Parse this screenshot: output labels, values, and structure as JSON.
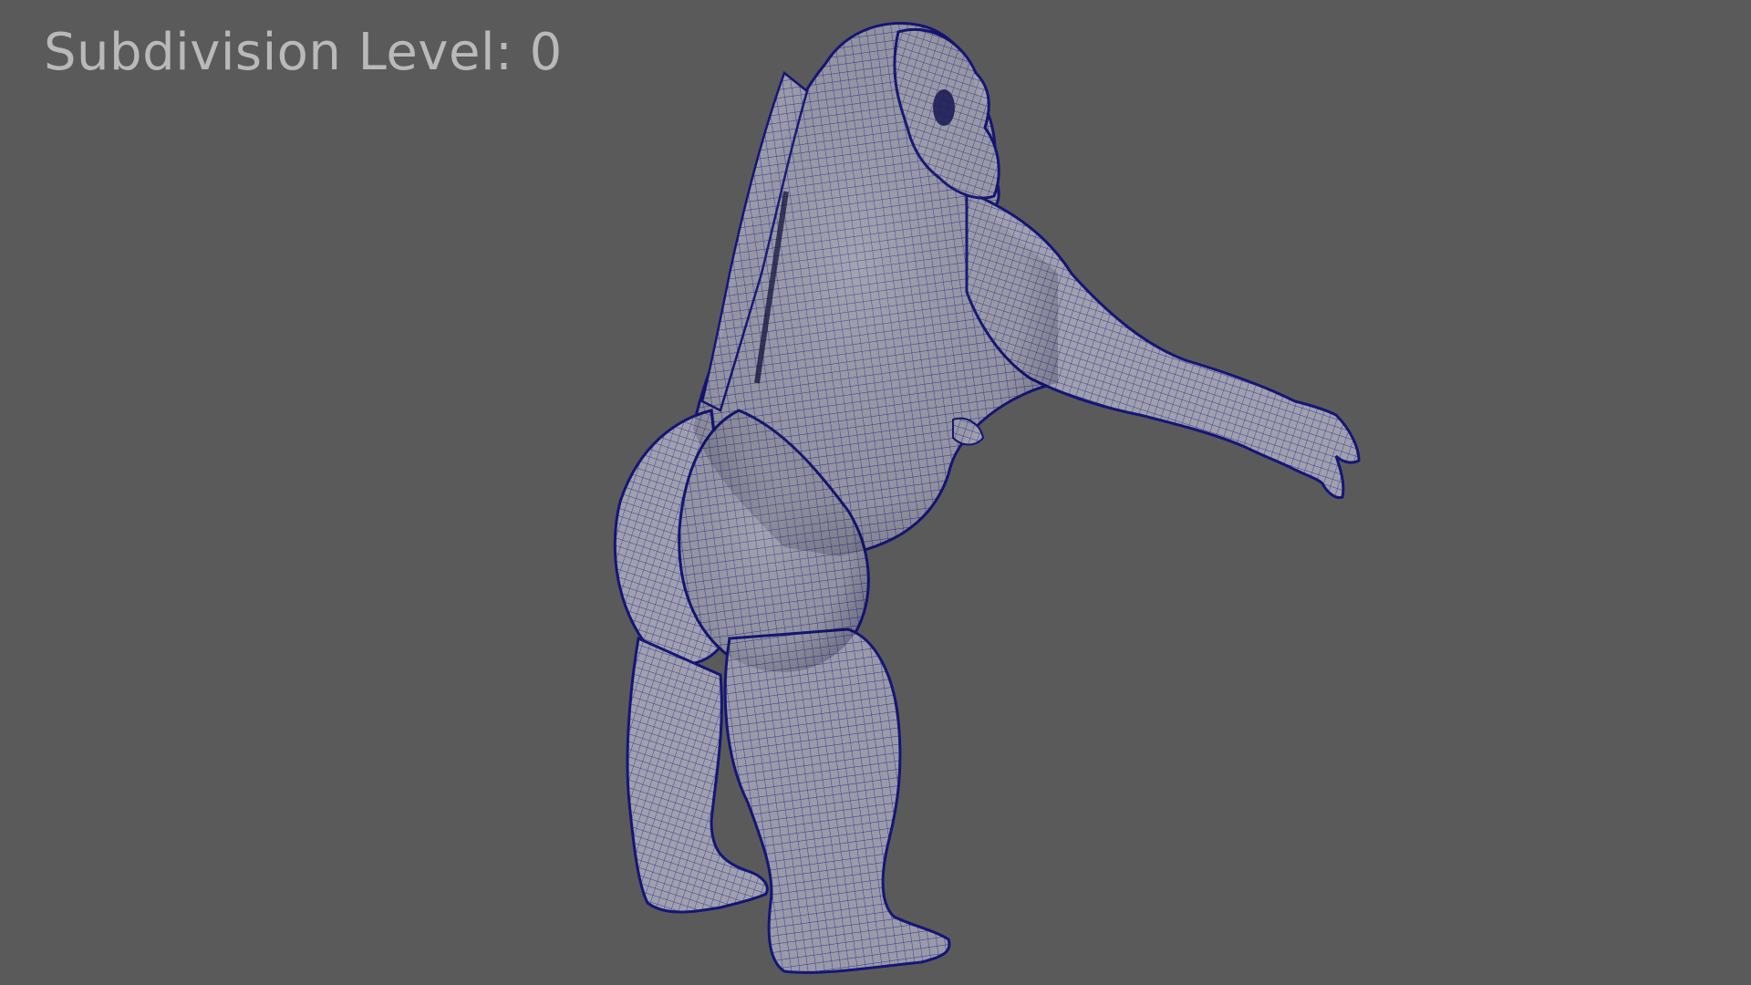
{
  "viewport": {
    "background_color": "#5a5a5a",
    "overlay_text": "Subdivision Level: 0",
    "overlay_color": "#b9b9b9"
  },
  "model": {
    "name": "gorilla-wireframe-mesh",
    "fill_color": "#9c9caa",
    "wire_color": "#1a1a8c",
    "edge_color": "#151577"
  }
}
